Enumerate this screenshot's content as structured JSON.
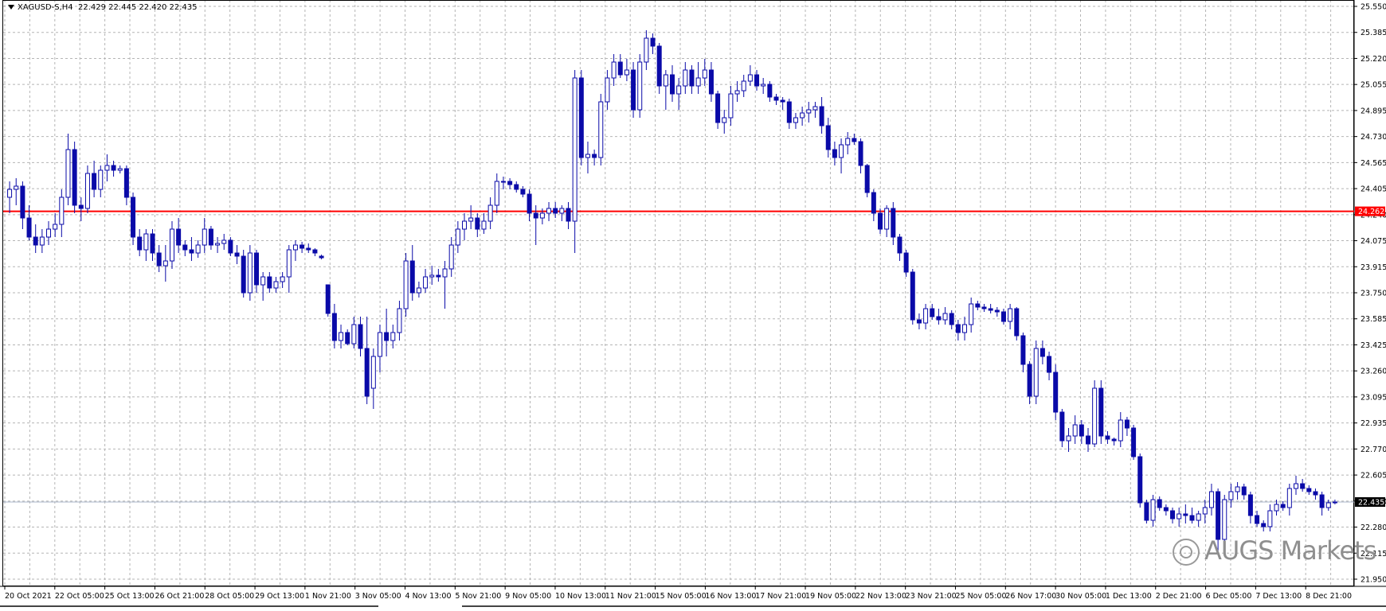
{
  "header": {
    "symbol": "XAGUSD-S,H4",
    "ohlc": "22.429 22.445 22.420 22.435"
  },
  "watermark": "AUGS Markets",
  "price_tags": {
    "red_line": "24.262",
    "current": "22.435"
  },
  "colors": {
    "candle": "#0a0aa8",
    "grid": "#b5b5b5",
    "red_line": "#ff0000",
    "current_line": "#a8b4c8"
  },
  "chart_data": {
    "type": "candlestick",
    "symbol": "XAGUSD-S",
    "timeframe": "H4",
    "ylim": [
      21.95,
      25.55
    ],
    "y_ticks": [
      "25.550",
      "25.385",
      "25.220",
      "25.055",
      "24.895",
      "24.730",
      "24.565",
      "24.405",
      "24.240",
      "24.075",
      "23.915",
      "23.750",
      "23.585",
      "23.425",
      "23.260",
      "23.095",
      "22.935",
      "22.770",
      "22.605",
      "22.440",
      "22.280",
      "22.115",
      "21.950"
    ],
    "x_tick_labels": [
      "20 Oct 2021",
      "22 Oct 05:00",
      "25 Oct 13:00",
      "26 Oct 21:00",
      "28 Oct 05:00",
      "29 Oct 13:00",
      "1 Nov 21:00",
      "3 Nov 05:00",
      "4 Nov 13:00",
      "5 Nov 21:00",
      "9 Nov 05:00",
      "10 Nov 13:00",
      "11 Nov 21:00",
      "15 Nov 05:00",
      "16 Nov 13:00",
      "17 Nov 21:00",
      "19 Nov 05:00",
      "22 Nov 13:00",
      "23 Nov 21:00",
      "25 Nov 05:00",
      "26 Nov 17:00",
      "30 Nov 05:00",
      "1 Dec 13:00",
      "2 Dec 21:00",
      "6 Dec 05:00",
      "7 Dec 13:00",
      "8 Dec 21:00"
    ],
    "horizontal_lines": [
      {
        "label": "24.262",
        "value": 24.262
      },
      {
        "label": "22.435",
        "value": 22.435
      }
    ],
    "candles": [
      [
        24.35,
        24.45,
        24.25,
        24.4
      ],
      [
        24.4,
        24.47,
        24.3,
        24.42
      ],
      [
        24.42,
        24.45,
        24.15,
        24.22
      ],
      [
        24.22,
        24.3,
        24.08,
        24.1
      ],
      [
        24.1,
        24.18,
        24.0,
        24.05
      ],
      [
        24.05,
        24.15,
        24.0,
        24.1
      ],
      [
        24.1,
        24.2,
        24.05,
        24.15
      ],
      [
        24.15,
        24.25,
        24.1,
        24.18
      ],
      [
        24.18,
        24.4,
        24.1,
        24.35
      ],
      [
        24.35,
        24.75,
        24.3,
        24.65
      ],
      [
        24.65,
        24.7,
        24.25,
        24.3
      ],
      [
        24.3,
        24.35,
        24.2,
        24.28
      ],
      [
        24.28,
        24.55,
        24.25,
        24.5
      ],
      [
        24.5,
        24.58,
        24.35,
        24.4
      ],
      [
        24.4,
        24.55,
        24.35,
        24.52
      ],
      [
        24.52,
        24.62,
        24.45,
        24.55
      ],
      [
        24.55,
        24.58,
        24.48,
        24.52
      ],
      [
        24.52,
        24.55,
        24.5,
        24.53
      ],
      [
        24.53,
        24.55,
        24.3,
        24.35
      ],
      [
        24.35,
        24.38,
        24.05,
        24.1
      ],
      [
        24.1,
        24.15,
        23.98,
        24.02
      ],
      [
        24.02,
        24.15,
        23.95,
        24.12
      ],
      [
        24.12,
        24.15,
        23.95,
        24.0
      ],
      [
        24.0,
        24.05,
        23.88,
        23.92
      ],
      [
        23.92,
        24.05,
        23.82,
        23.95
      ],
      [
        23.95,
        24.2,
        23.9,
        24.15
      ],
      [
        24.15,
        24.22,
        24.0,
        24.05
      ],
      [
        24.05,
        24.08,
        23.98,
        24.02
      ],
      [
        24.02,
        24.1,
        23.95,
        24.0
      ],
      [
        24.0,
        24.08,
        23.97,
        24.05
      ],
      [
        24.05,
        24.22,
        24.0,
        24.15
      ],
      [
        24.15,
        24.17,
        24.02,
        24.05
      ],
      [
        24.05,
        24.1,
        24.0,
        24.06
      ],
      [
        24.06,
        24.12,
        24.02,
        24.08
      ],
      [
        24.08,
        24.1,
        23.98,
        24.0
      ],
      [
        24.0,
        24.05,
        23.93,
        23.98
      ],
      [
        23.98,
        24.02,
        23.72,
        23.75
      ],
      [
        23.75,
        24.05,
        23.7,
        24.0
      ],
      [
        24.0,
        24.02,
        23.75,
        23.8
      ],
      [
        23.8,
        23.88,
        23.7,
        23.85
      ],
      [
        23.85,
        23.88,
        23.75,
        23.78
      ],
      [
        23.78,
        23.85,
        23.75,
        23.82
      ],
      [
        23.82,
        23.88,
        23.78,
        23.85
      ],
      [
        23.85,
        24.05,
        23.75,
        24.02
      ],
      [
        24.02,
        24.08,
        23.95,
        24.05
      ],
      [
        24.05,
        24.07,
        24.0,
        24.03
      ],
      [
        24.03,
        24.06,
        24.0,
        24.02
      ],
      [
        24.02,
        24.03,
        23.98,
        24.0
      ],
      [
        23.98,
        23.99,
        23.96,
        23.97
      ],
      [
        23.8,
        23.8,
        23.6,
        23.62
      ],
      [
        23.62,
        23.68,
        23.4,
        23.45
      ],
      [
        23.45,
        23.55,
        23.4,
        23.5
      ],
      [
        23.5,
        23.52,
        23.42,
        23.43
      ],
      [
        23.43,
        23.6,
        23.4,
        23.55
      ],
      [
        23.55,
        23.6,
        23.35,
        23.4
      ],
      [
        23.4,
        23.6,
        23.05,
        23.1
      ],
      [
        23.15,
        23.4,
        23.02,
        23.35
      ],
      [
        23.35,
        23.55,
        23.25,
        23.5
      ],
      [
        23.5,
        23.65,
        23.35,
        23.45
      ],
      [
        23.45,
        23.55,
        23.4,
        23.5
      ],
      [
        23.5,
        23.7,
        23.45,
        23.65
      ],
      [
        23.65,
        24.0,
        23.6,
        23.95
      ],
      [
        23.95,
        24.05,
        23.7,
        23.75
      ],
      [
        23.75,
        23.82,
        23.72,
        23.78
      ],
      [
        23.78,
        23.9,
        23.75,
        23.85
      ],
      [
        23.85,
        23.92,
        23.8,
        23.86
      ],
      [
        23.86,
        23.9,
        23.82,
        23.85
      ],
      [
        23.85,
        23.95,
        23.65,
        23.9
      ],
      [
        23.9,
        24.1,
        23.85,
        24.05
      ],
      [
        24.05,
        24.2,
        24.0,
        24.15
      ],
      [
        24.15,
        24.25,
        24.08,
        24.2
      ],
      [
        24.2,
        24.3,
        24.15,
        24.22
      ],
      [
        24.22,
        24.25,
        24.1,
        24.15
      ],
      [
        24.15,
        24.25,
        24.12,
        24.2
      ],
      [
        24.2,
        24.35,
        24.15,
        24.3
      ],
      [
        24.3,
        24.5,
        24.25,
        24.45
      ],
      [
        24.45,
        24.48,
        24.4,
        24.45
      ],
      [
        24.45,
        24.47,
        24.4,
        24.43
      ],
      [
        24.43,
        24.45,
        24.38,
        24.4
      ],
      [
        24.4,
        24.42,
        24.35,
        24.37
      ],
      [
        24.37,
        24.4,
        24.2,
        24.25
      ],
      [
        24.25,
        24.3,
        24.05,
        24.22
      ],
      [
        24.22,
        24.28,
        24.18,
        24.25
      ],
      [
        24.25,
        24.32,
        24.2,
        24.28
      ],
      [
        24.28,
        24.32,
        24.22,
        24.25
      ],
      [
        24.25,
        24.3,
        24.2,
        24.28
      ],
      [
        24.28,
        24.32,
        24.15,
        24.2
      ],
      [
        24.2,
        25.15,
        24.0,
        25.1
      ],
      [
        25.1,
        25.15,
        24.55,
        24.6
      ],
      [
        24.6,
        24.7,
        24.5,
        24.62
      ],
      [
        24.62,
        24.65,
        24.55,
        24.6
      ],
      [
        24.6,
        25.0,
        24.55,
        24.95
      ],
      [
        24.95,
        25.15,
        24.9,
        25.1
      ],
      [
        25.1,
        25.25,
        25.05,
        25.2
      ],
      [
        25.2,
        25.25,
        25.1,
        25.12
      ],
      [
        25.12,
        25.22,
        25.08,
        25.15
      ],
      [
        25.15,
        25.2,
        24.85,
        24.9
      ],
      [
        24.9,
        25.25,
        24.85,
        25.2
      ],
      [
        25.2,
        25.4,
        25.15,
        25.35
      ],
      [
        25.35,
        25.38,
        25.25,
        25.3
      ],
      [
        25.3,
        25.32,
        25.0,
        25.05
      ],
      [
        25.05,
        25.15,
        24.9,
        25.12
      ],
      [
        25.12,
        25.18,
        24.95,
        25.0
      ],
      [
        25.0,
        25.1,
        24.9,
        25.05
      ],
      [
        25.05,
        25.2,
        25.0,
        25.15
      ],
      [
        25.15,
        25.18,
        25.0,
        25.05
      ],
      [
        25.05,
        25.2,
        25.0,
        25.1
      ],
      [
        25.1,
        25.22,
        25.05,
        25.15
      ],
      [
        25.15,
        25.2,
        24.95,
        25.0
      ],
      [
        25.0,
        25.02,
        24.78,
        24.82
      ],
      [
        24.82,
        24.9,
        24.75,
        24.85
      ],
      [
        24.85,
        25.05,
        24.8,
        25.0
      ],
      [
        25.0,
        25.08,
        24.95,
        25.02
      ],
      [
        25.02,
        25.12,
        24.98,
        25.08
      ],
      [
        25.08,
        25.18,
        25.05,
        25.12
      ],
      [
        25.12,
        25.15,
        25.02,
        25.05
      ],
      [
        25.05,
        25.1,
        25.0,
        25.06
      ],
      [
        25.06,
        25.08,
        24.95,
        24.98
      ],
      [
        24.98,
        25.0,
        24.93,
        24.96
      ],
      [
        24.96,
        24.98,
        24.9,
        24.95
      ],
      [
        24.95,
        24.97,
        24.78,
        24.82
      ],
      [
        24.82,
        24.88,
        24.78,
        24.85
      ],
      [
        24.85,
        24.92,
        24.8,
        24.88
      ],
      [
        24.88,
        24.95,
        24.82,
        24.9
      ],
      [
        24.9,
        24.95,
        24.85,
        24.92
      ],
      [
        24.92,
        24.98,
        24.75,
        24.8
      ],
      [
        24.8,
        24.85,
        24.6,
        24.65
      ],
      [
        24.65,
        24.7,
        24.55,
        24.6
      ],
      [
        24.6,
        24.72,
        24.5,
        24.68
      ],
      [
        24.68,
        24.76,
        24.62,
        24.72
      ],
      [
        24.72,
        24.75,
        24.68,
        24.7
      ],
      [
        24.7,
        24.72,
        24.5,
        24.55
      ],
      [
        24.55,
        24.56,
        24.35,
        24.38
      ],
      [
        24.38,
        24.4,
        24.2,
        24.25
      ],
      [
        24.25,
        24.28,
        24.12,
        24.15
      ],
      [
        24.15,
        24.3,
        24.1,
        24.28
      ],
      [
        24.28,
        24.32,
        24.05,
        24.1
      ],
      [
        24.1,
        24.12,
        23.95,
        24.0
      ],
      [
        24.0,
        24.02,
        23.85,
        23.88
      ],
      [
        23.88,
        23.9,
        23.55,
        23.58
      ],
      [
        23.58,
        23.62,
        23.52,
        23.56
      ],
      [
        23.56,
        23.68,
        23.52,
        23.65
      ],
      [
        23.65,
        23.68,
        23.58,
        23.6
      ],
      [
        23.6,
        23.65,
        23.55,
        23.58
      ],
      [
        23.58,
        23.66,
        23.55,
        23.62
      ],
      [
        23.62,
        23.64,
        23.52,
        23.55
      ],
      [
        23.55,
        23.58,
        23.45,
        23.5
      ],
      [
        23.5,
        23.6,
        23.45,
        23.55
      ],
      [
        23.55,
        23.72,
        23.5,
        23.68
      ],
      [
        23.68,
        23.7,
        23.64,
        23.66
      ],
      [
        23.66,
        23.68,
        23.63,
        23.65
      ],
      [
        23.65,
        23.68,
        23.62,
        23.64
      ],
      [
        23.64,
        23.66,
        23.6,
        23.63
      ],
      [
        23.63,
        23.65,
        23.55,
        23.57
      ],
      [
        23.57,
        23.68,
        23.52,
        23.65
      ],
      [
        23.65,
        23.66,
        23.45,
        23.48
      ],
      [
        23.48,
        23.5,
        23.25,
        23.3
      ],
      [
        23.3,
        23.32,
        23.05,
        23.1
      ],
      [
        23.1,
        23.45,
        23.05,
        23.4
      ],
      [
        23.4,
        23.45,
        23.3,
        23.35
      ],
      [
        23.35,
        23.38,
        23.2,
        23.25
      ],
      [
        23.25,
        23.3,
        22.95,
        23.0
      ],
      [
        23.0,
        23.02,
        22.78,
        22.82
      ],
      [
        22.82,
        22.9,
        22.75,
        22.85
      ],
      [
        22.85,
        22.98,
        22.8,
        22.92
      ],
      [
        22.92,
        22.95,
        22.8,
        22.85
      ],
      [
        22.85,
        22.9,
        22.75,
        22.8
      ],
      [
        22.8,
        23.2,
        22.78,
        23.15
      ],
      [
        23.15,
        23.2,
        22.8,
        22.85
      ],
      [
        22.85,
        22.88,
        22.8,
        22.83
      ],
      [
        22.83,
        22.84,
        22.79,
        22.82
      ],
      [
        22.82,
        23.0,
        22.78,
        22.95
      ],
      [
        22.95,
        22.97,
        22.85,
        22.9
      ],
      [
        22.9,
        22.92,
        22.7,
        22.72
      ],
      [
        22.72,
        22.74,
        22.4,
        22.43
      ],
      [
        22.43,
        22.45,
        22.3,
        22.32
      ],
      [
        22.32,
        22.48,
        22.28,
        22.45
      ],
      [
        22.45,
        22.47,
        22.38,
        22.4
      ],
      [
        22.4,
        22.42,
        22.35,
        22.38
      ],
      [
        22.38,
        22.4,
        22.3,
        22.33
      ],
      [
        22.33,
        22.4,
        22.28,
        22.36
      ],
      [
        22.36,
        22.42,
        22.3,
        22.35
      ],
      [
        22.35,
        22.4,
        22.3,
        22.32
      ],
      [
        22.32,
        22.38,
        22.28,
        22.36
      ],
      [
        22.36,
        22.45,
        22.3,
        22.4
      ],
      [
        22.4,
        22.55,
        22.35,
        22.5
      ],
      [
        22.5,
        22.52,
        22.12,
        22.2
      ],
      [
        22.2,
        22.48,
        22.15,
        22.45
      ],
      [
        22.45,
        22.55,
        22.4,
        22.5
      ],
      [
        22.5,
        22.56,
        22.45,
        22.53
      ],
      [
        22.53,
        22.55,
        22.45,
        22.48
      ],
      [
        22.48,
        22.5,
        22.3,
        22.35
      ],
      [
        22.35,
        22.38,
        22.28,
        22.3
      ],
      [
        22.3,
        22.32,
        22.25,
        22.28
      ],
      [
        22.28,
        22.42,
        22.25,
        22.38
      ],
      [
        22.38,
        22.45,
        22.35,
        22.42
      ],
      [
        22.42,
        22.44,
        22.38,
        22.4
      ],
      [
        22.4,
        22.55,
        22.35,
        22.52
      ],
      [
        22.52,
        22.6,
        22.48,
        22.55
      ],
      [
        22.55,
        22.58,
        22.5,
        22.52
      ],
      [
        22.52,
        22.54,
        22.48,
        22.5
      ],
      [
        22.5,
        22.52,
        22.45,
        22.48
      ],
      [
        22.48,
        22.5,
        22.35,
        22.4
      ],
      [
        22.4,
        22.45,
        22.38,
        22.43
      ],
      [
        22.43,
        22.45,
        22.42,
        22.435
      ]
    ]
  }
}
